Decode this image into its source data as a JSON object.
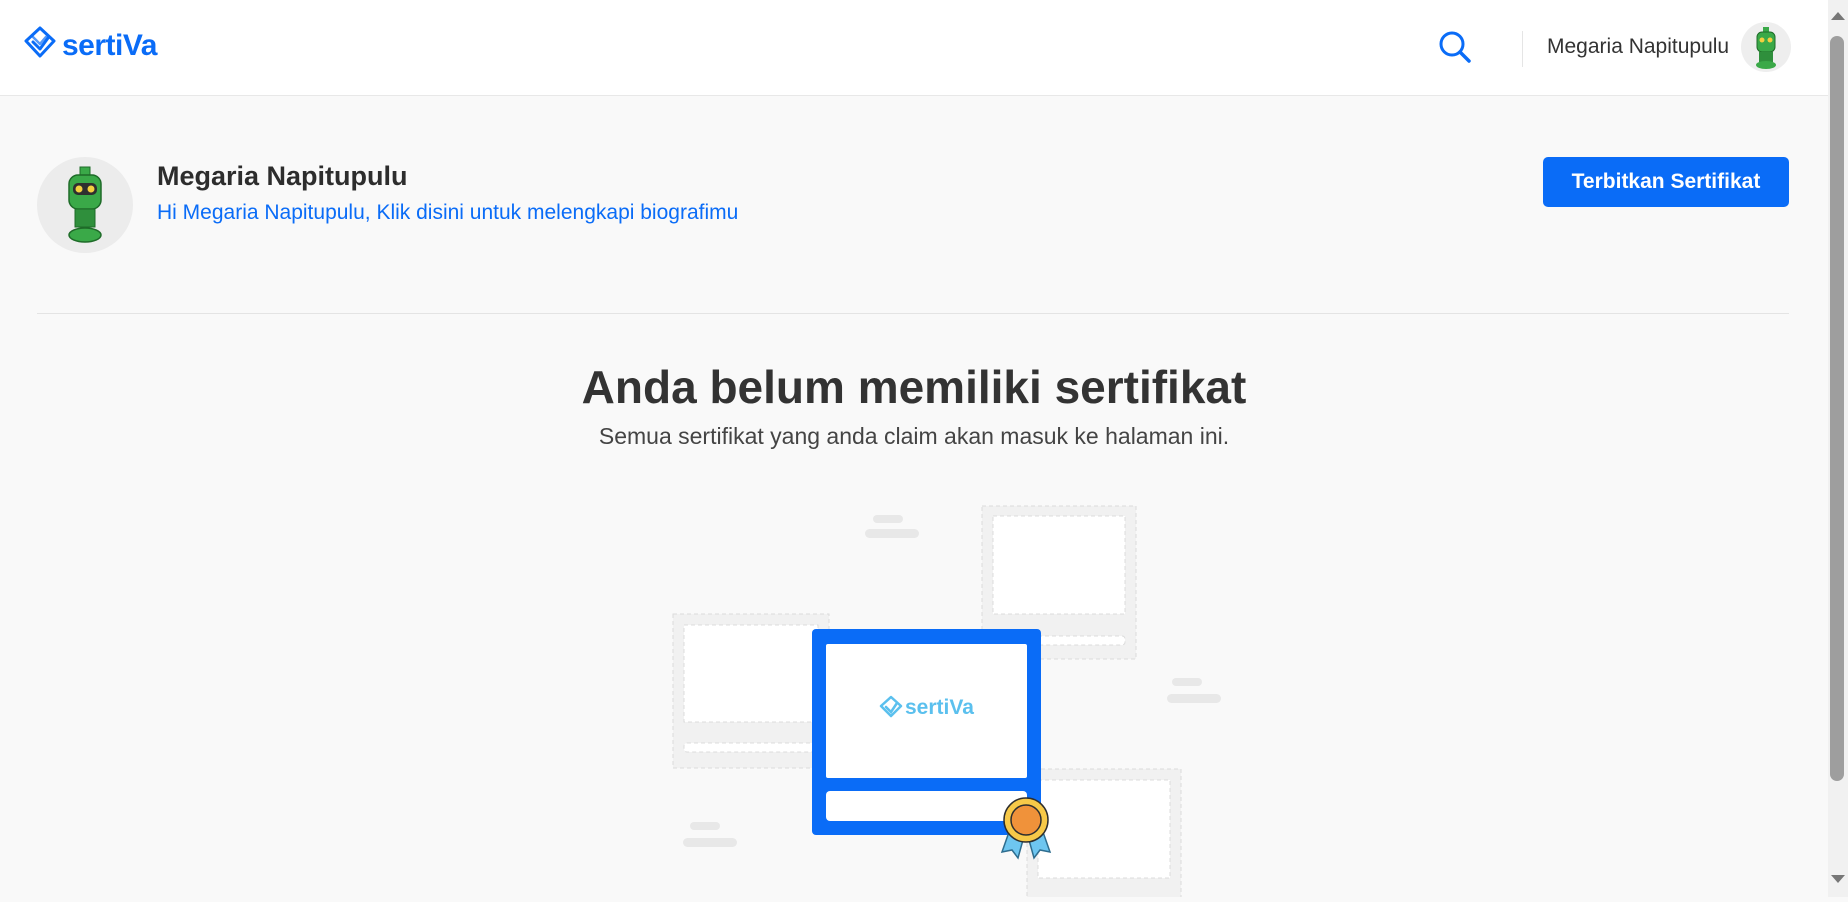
{
  "header": {
    "logo_text": "sertiVa",
    "search_icon": "search-icon",
    "user_name": "Megaria Napitupulu"
  },
  "profile": {
    "name": "Megaria Napitupulu",
    "bio_link": "Hi Megaria Napitupulu, Klik disini untuk melengkapi biografimu",
    "issue_button": "Terbitkan Sertifikat"
  },
  "empty_state": {
    "title": "Anda belum memiliki sertifikat",
    "subtitle": "Semua sertifikat yang anda claim akan masuk ke halaman ini.",
    "illustration_logo": "sertiVa"
  },
  "colors": {
    "brand": "#0a6cf7",
    "background": "#f9f9f9",
    "robot_green": "#3aa948",
    "ribbon_orange": "#f0923a",
    "ribbon_blue": "#6ec6f0"
  }
}
